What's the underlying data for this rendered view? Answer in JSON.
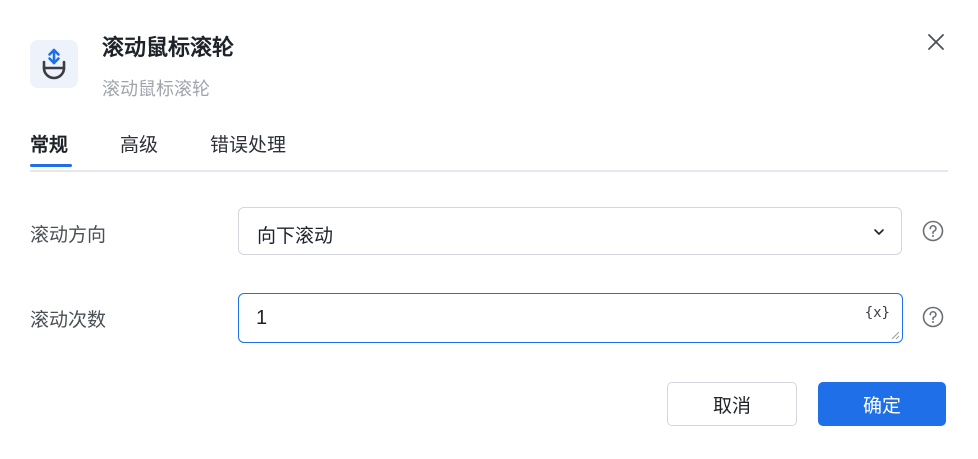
{
  "dialog": {
    "title": "滚动鼠标滚轮",
    "subtitle": "滚动鼠标滚轮"
  },
  "tabs": [
    {
      "label": "常规",
      "active": true
    },
    {
      "label": "高级",
      "active": false
    },
    {
      "label": "错误处理",
      "active": false
    }
  ],
  "form": {
    "direction": {
      "label": "滚动方向",
      "value": "向下滚动"
    },
    "count": {
      "label": "滚动次数",
      "value": "1",
      "variable_button": "{x}"
    }
  },
  "buttons": {
    "cancel": "取消",
    "confirm": "确定"
  },
  "colors": {
    "primary": "#1e6fe8",
    "muted_text": "#a0a4ab"
  },
  "icons": {
    "app": "mouse-scroll-icon",
    "close": "close-icon",
    "dropdown": "chevron-down-icon",
    "help": "help-circle-icon"
  }
}
